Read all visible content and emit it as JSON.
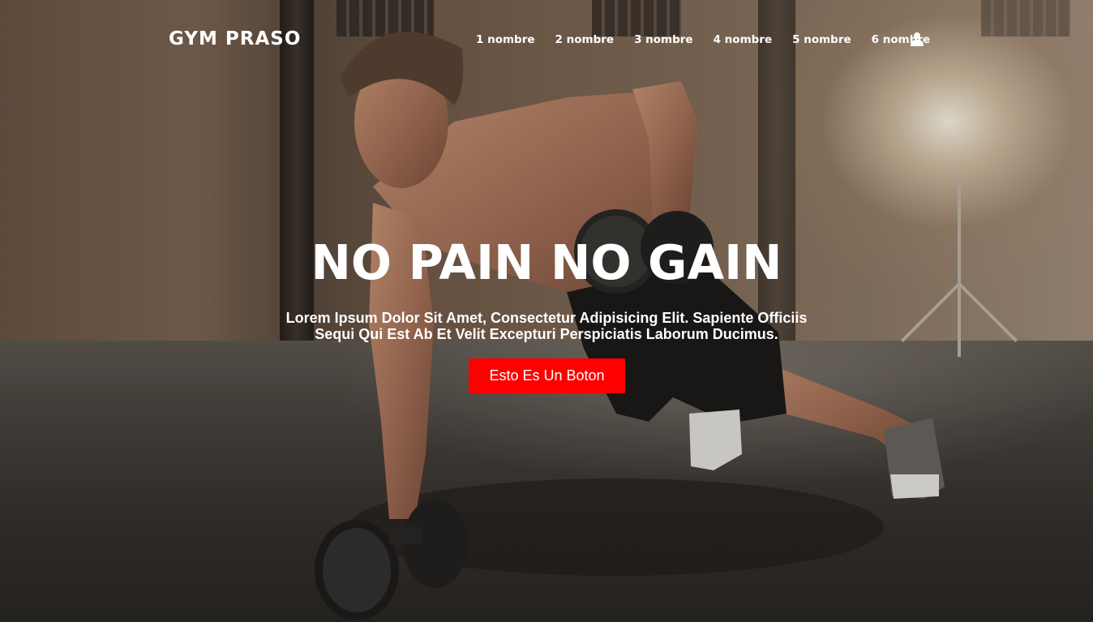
{
  "header": {
    "brand": "GYM PRASO",
    "nav_items": [
      {
        "label": "1 nombre"
      },
      {
        "label": "2 nombre"
      },
      {
        "label": "3 nombre"
      },
      {
        "label": "4 nombre"
      },
      {
        "label": "5 nombre"
      },
      {
        "label": "6 nombre"
      }
    ],
    "user_icon": "user-icon"
  },
  "hero": {
    "title": "NO PAIN NO GAIN",
    "text": "Lorem Ipsum Dolor Sit Amet, Consectetur Adipisicing Elit. Sapiente Officiis Sequi Qui Est Ab Et Velit Excepturi Perspiciatis Laborum Ducimus.",
    "button_label": "Esto Es Un Boton"
  },
  "colors": {
    "accent": "#ff0000",
    "text": "#ffffff"
  }
}
